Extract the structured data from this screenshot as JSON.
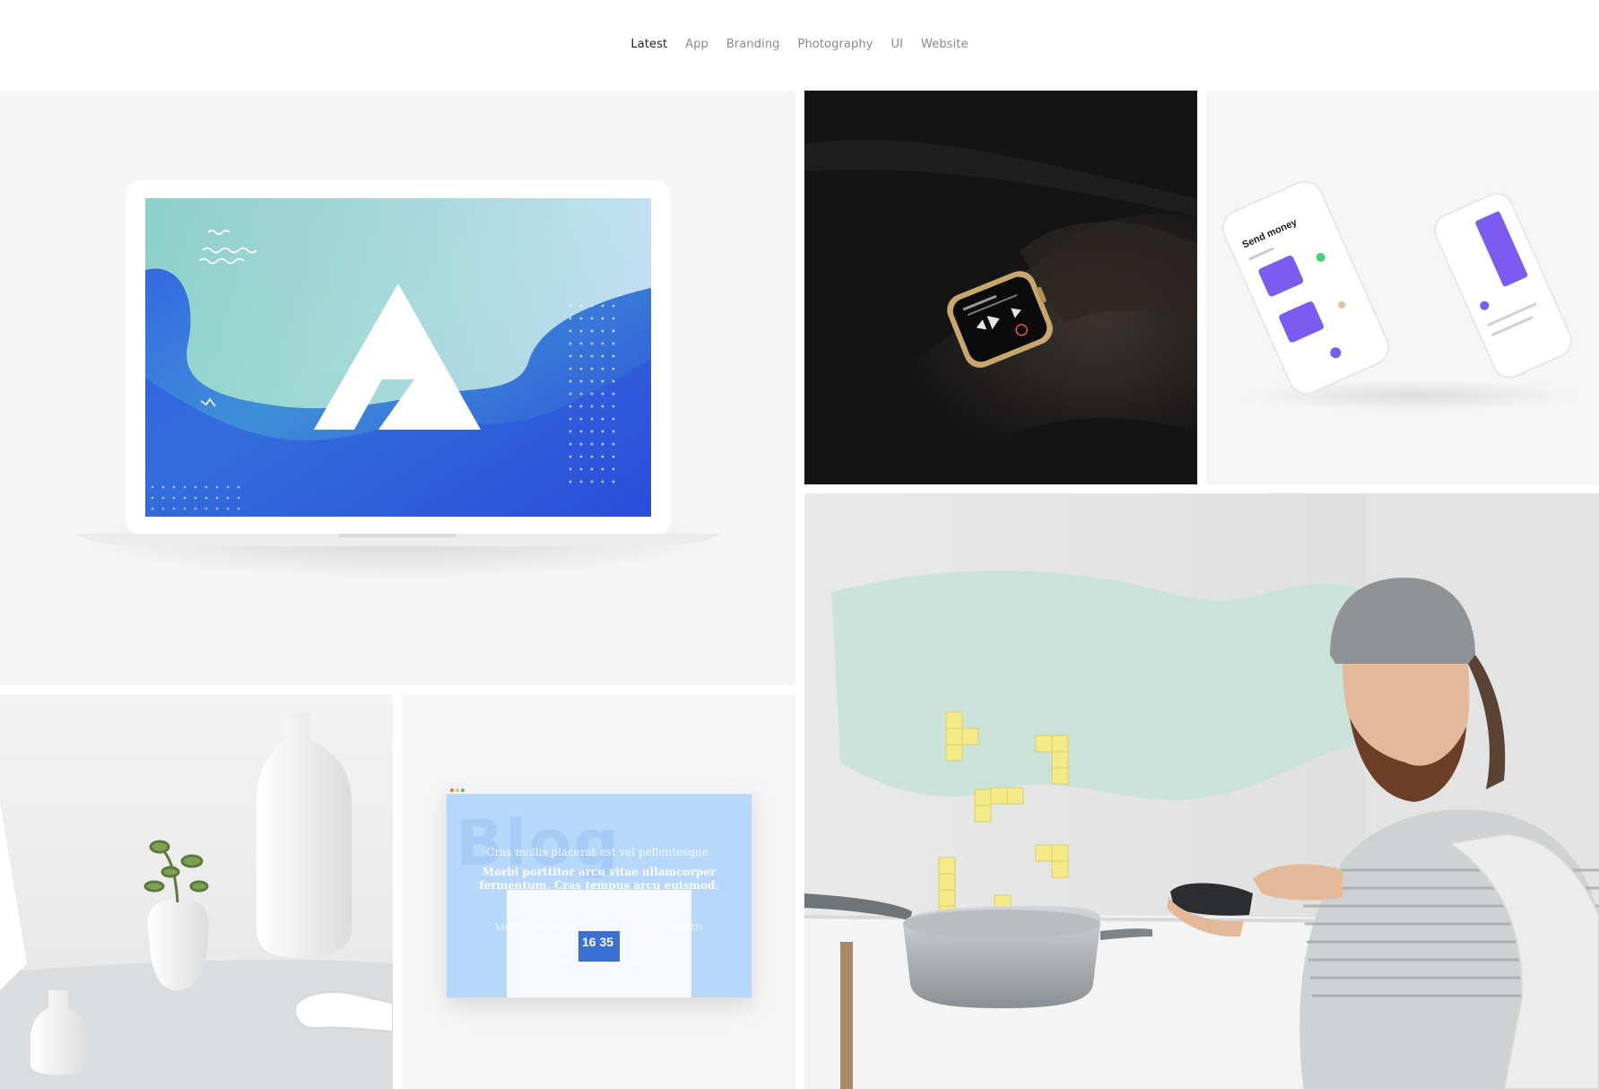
{
  "filters": {
    "items": [
      {
        "label": "Latest",
        "active": true
      },
      {
        "label": "App"
      },
      {
        "label": "Branding"
      },
      {
        "label": "Photography"
      },
      {
        "label": "UI"
      },
      {
        "label": "Website"
      }
    ]
  },
  "tiles": {
    "app": {
      "phone_heading": "Send money"
    },
    "website": {
      "bg_word": "Blog",
      "line1": "Cras mollis placerat est vel pellentesque.",
      "line2": "Morbi porttitor arcu vitae ullamcorper",
      "line3": "fermentum. Cras tempus arcu euismod.",
      "line4": "Vestibulum et magna vitae... Quis sagittis",
      "line5": "luctus rhoncus nibh...",
      "clock": "16 35"
    }
  },
  "colors": {
    "accent_blue": "#2b52e0",
    "active_text": "#1e1e1e",
    "inactive_text": "#8a8a8a",
    "app_purple": "#7b5cf0",
    "website_blue": "#b8d8fb"
  }
}
